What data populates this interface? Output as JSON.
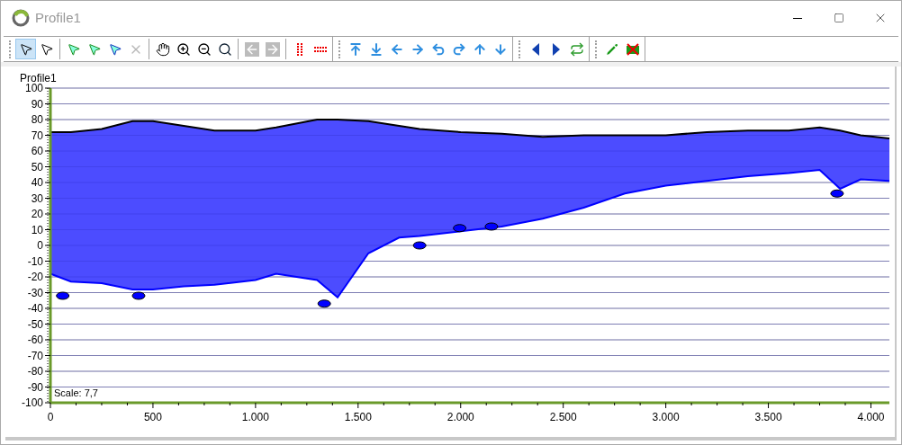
{
  "window": {
    "title": "Profile1"
  },
  "toolbar": {
    "bands": [
      [
        [
          {
            "kind": "pointer",
            "selected": true,
            "disabled": false
          },
          {
            "kind": "select-list",
            "selected": false,
            "disabled": false
          }
        ],
        [
          {
            "kind": "node-a",
            "selected": false,
            "disabled": false
          },
          {
            "kind": "node-b",
            "selected": false,
            "disabled": false
          },
          {
            "kind": "node-c",
            "selected": false,
            "disabled": false
          },
          {
            "kind": "delete",
            "selected": false,
            "disabled": true
          }
        ],
        [
          {
            "kind": "hand",
            "selected": false,
            "disabled": false
          },
          {
            "kind": "zoom-in",
            "selected": false,
            "disabled": false
          },
          {
            "kind": "zoom-out",
            "selected": false,
            "disabled": false
          },
          {
            "kind": "zoom-fit",
            "selected": false,
            "disabled": false
          }
        ],
        [
          {
            "kind": "back",
            "selected": false,
            "disabled": true
          },
          {
            "kind": "forward",
            "selected": false,
            "disabled": true
          }
        ],
        [
          {
            "kind": "vlines",
            "selected": false,
            "disabled": false
          },
          {
            "kind": "hlines",
            "selected": false,
            "disabled": false
          }
        ]
      ],
      [
        [
          {
            "kind": "to-top",
            "selected": false,
            "disabled": false
          },
          {
            "kind": "to-bottom",
            "selected": false,
            "disabled": false
          },
          {
            "kind": "left",
            "selected": false,
            "disabled": false
          },
          {
            "kind": "right",
            "selected": false,
            "disabled": false
          },
          {
            "kind": "undo",
            "selected": false,
            "disabled": false
          },
          {
            "kind": "redo",
            "selected": false,
            "disabled": false
          },
          {
            "kind": "up",
            "selected": false,
            "disabled": false
          },
          {
            "kind": "down",
            "selected": false,
            "disabled": false
          }
        ]
      ],
      [
        [
          {
            "kind": "prev",
            "selected": false,
            "disabled": false
          },
          {
            "kind": "next",
            "selected": false,
            "disabled": false
          },
          {
            "kind": "swap",
            "selected": false,
            "disabled": false
          }
        ]
      ],
      [
        [
          {
            "kind": "edit",
            "selected": false,
            "disabled": false
          },
          {
            "kind": "remove",
            "selected": false,
            "disabled": false
          }
        ]
      ]
    ]
  },
  "chart": {
    "scale_label": "Scale: 7,7",
    "chart_data": {
      "type": "area",
      "title": "Profile1",
      "x": [
        0,
        100,
        250,
        400,
        500,
        650,
        800,
        1000,
        1100,
        1300,
        1400,
        1550,
        1700,
        1800,
        2000,
        2200,
        2400,
        2600,
        2800,
        3000,
        3200,
        3400,
        3600,
        3750,
        3850,
        3950,
        4090
      ],
      "series": [
        {
          "type": "line",
          "color": "#000000",
          "values": [
            72,
            72,
            74,
            79,
            79,
            76,
            73,
            73,
            75,
            80,
            80,
            79,
            76,
            74,
            72,
            71,
            69,
            70,
            70,
            70,
            72,
            73,
            73,
            75,
            73,
            70,
            68
          ]
        },
        {
          "type": "line",
          "color": "#0000ff",
          "values": [
            -18,
            -23,
            -24,
            -28,
            -28,
            -26,
            -25,
            -22,
            -18,
            -22,
            -33,
            -5,
            5,
            6,
            9,
            12,
            17,
            24,
            33,
            38,
            41,
            44,
            46,
            48,
            36,
            42,
            41
          ]
        },
        {
          "type": "scatter",
          "color": "#0000ff",
          "x": [
            60,
            430,
            1335,
            1800,
            1995,
            2150,
            3835
          ],
          "values": [
            -32,
            -32,
            -37,
            0,
            11,
            12,
            33
          ]
        }
      ],
      "grid": true,
      "xlim": [
        0,
        4090
      ],
      "ylim": [
        -100,
        100
      ],
      "xticks": [
        0,
        {
          "value": 500,
          "label": "500"
        },
        {
          "value": 1000,
          "label": "1.000"
        },
        {
          "value": 1500,
          "label": "1.500"
        },
        {
          "value": 2000,
          "label": "2.000"
        },
        {
          "value": 2500,
          "label": "2.500"
        },
        {
          "value": 3000,
          "label": "3.000"
        },
        {
          "value": 3500,
          "label": "3.500"
        },
        {
          "value": 4000,
          "label": "4.000"
        }
      ],
      "yticks": [
        -100,
        -90,
        -80,
        -70,
        -60,
        -50,
        -40,
        -30,
        -20,
        -10,
        0,
        10,
        20,
        30,
        40,
        50,
        60,
        70,
        80,
        90,
        100
      ]
    }
  }
}
